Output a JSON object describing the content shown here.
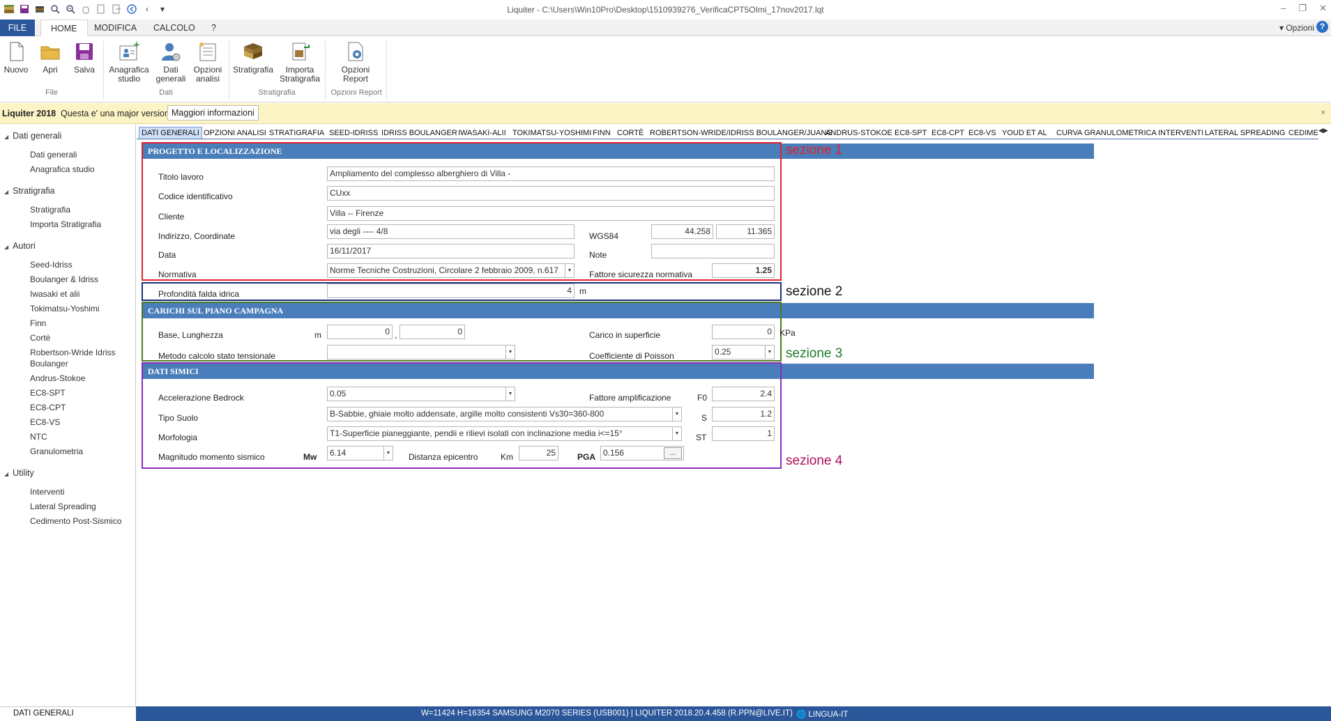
{
  "window": {
    "title": "Liquiter - C:\\Users\\Win10Pro\\Desktop\\1510939276_VerificaCPT5OImi_17nov2017.lqt"
  },
  "ribbon_tabs": [
    "FILE",
    "HOME",
    "MODIFICA",
    "CALCOLO",
    "?"
  ],
  "ribbon_right": {
    "options": "Opzioni",
    "options_arrow": "▾",
    "help": "?"
  },
  "ribbon": {
    "nuovo": "Nuovo",
    "apri": "Apri",
    "salva": "Salva",
    "group_file": "File",
    "anagrafica_line1": "Anagrafica",
    "anagrafica_line2": "studio",
    "dati_line1": "Dati",
    "dati_line2": "generali",
    "opzioni_line1": "Opzioni",
    "opzioni_line2": "analisi",
    "group_dati": "Dati",
    "stratigrafia": "Stratigrafia",
    "importa_line1": "Importa",
    "importa_line2": "Stratigrafia",
    "group_stratigrafia": "Stratigrafia",
    "report_line1": "Opzioni",
    "report_line2": "Report",
    "group_report": "Opzioni Report"
  },
  "infobar": {
    "app": "Liquiter 2018",
    "message": "Questa e' una major version",
    "more": "Maggiori informazioni",
    "close": "×"
  },
  "nav": {
    "groups": [
      "Dati generali",
      "Stratigrafia",
      "Autori",
      "Utility"
    ],
    "dati": [
      "Dati generali",
      "Anagrafica studio"
    ],
    "strat": [
      "Stratigrafia",
      "Importa Stratigrafia"
    ],
    "autori": [
      "Seed-Idriss",
      "Boulanger & Idriss",
      "Iwasaki et alii",
      "Tokimatsu-Yoshimi",
      "Finn",
      "Cortè",
      "Robertson-Wride Idriss",
      "Boulanger",
      "Andrus-Stokoe",
      "EC8-SPT",
      "EC8-CPT",
      "EC8-VS",
      "NTC",
      "Granulometria"
    ],
    "utility": [
      "Interventi",
      "Lateral Spreading",
      "Cedimento Post-Sismico"
    ]
  },
  "content_tabs": [
    "DATI GENERALI",
    "OPZIONI ANALISI",
    "STRATIGRAFIA",
    "SEED-IDRISS",
    "IDRISS BOULANGER",
    "IWASAKI-ALII",
    "TOKIMATSU-YOSHIMI",
    "FINN",
    "CORTÈ",
    "ROBERTSON-WRIDE/IDRISS BOULANGER/JUANG",
    "ANDRUS-STOKOE",
    "EC8-SPT",
    "EC8-CPT",
    "EC8-VS",
    "YOUD ET AL",
    "CURVA GRANULOMETRICA",
    "INTERVENTI",
    "LATERAL SPREADING",
    "CEDIMEN"
  ],
  "sections": {
    "s1": {
      "header": "PROGETTO E LOCALIZZAZIONE",
      "label": "sezione 1",
      "titolo_label": "Titolo lavoro",
      "titolo": "Ampliamento del complesso alberghiero di Villa -",
      "codice_label": "Codice identificativo",
      "codice": "CUxx",
      "cliente_label": "Cliente",
      "cliente": "Villa --  Firenze",
      "indirizzo_label": "Indirizzo, Coordinate",
      "indirizzo": "via degli ---- 4/8",
      "wgs_label": "WGS84",
      "lat": "44.258",
      "lon": "11.365",
      "data_label": "Data",
      "data": "16/11/2017",
      "note_label": "Note",
      "note": "",
      "normativa_label": "Normativa",
      "normativa": "Norme Tecniche Costruzioni, Circolare 2 febbraio 2009, n.617",
      "fattore_label": "Fattore sicurezza normativa",
      "fattore": "1.25"
    },
    "s2": {
      "label": "sezione 2",
      "falda_label": "Profondità falda idrica",
      "falda": "4",
      "unit": "m"
    },
    "s3": {
      "header": "CARICHI SUL PIANO CAMPAGNA",
      "label": "sezione 3",
      "base_label": "Base, Lunghezza",
      "unit_m": "m",
      "base": "0",
      "comma": ",",
      "lunghezza": "0",
      "carico_label": "Carico in superficie",
      "carico": "0",
      "carico_unit": "KPa",
      "metodo_label": "Metodo calcolo stato tensionale",
      "metodo": "",
      "poisson_label": "Coefficiente di Poisson",
      "poisson": "0.25"
    },
    "s4": {
      "header": "DATI SIMICI",
      "label": "sezione 4",
      "acc_label": "Accelerazione Bedrock",
      "acc": "0.05",
      "fatt_label": "Fattore amplificazione",
      "f0_label": "F0",
      "f0": "2.4",
      "suolo_label": "Tipo Suolo",
      "suolo": "B-Sabbie, ghiaie molto addensate, argille molto consistenti Vs30=360-800",
      "s_label": "S",
      "s": "1.2",
      "morf_label": "Morfologia",
      "morf": "T1-Superficie pianeggiante, pendii e rilievi isolati con inclinazione media i<=15°",
      "st_label": "ST",
      "st": "1",
      "mag_label": "Magnitudo momento sismico",
      "mw_label": "Mw",
      "mw": "6.14",
      "dist_label": "Distanza epicentro",
      "km_label": "Km",
      "dist": "25",
      "pga_label": "PGA",
      "pga": "0.156",
      "dots": "..."
    }
  },
  "status": {
    "left": "DATI GENERALI",
    "mid": "W=11424 H=16354 SAMSUNG M2070 SERIES (USB001) |     LIQUITER 2018.20.4.458 (R.PPN@LIVE.IT)",
    "lang": "LINGUA-IT"
  },
  "colors": {
    "accent": "#2b579a",
    "section_header": "#4a7eba",
    "s1": "#e0212b",
    "s2": "#1c2f7a",
    "s3": "#4d7a1e",
    "s4": "#8a2bbf",
    "label_s1": "#e0212b",
    "label_s2": "#111111",
    "label_s3": "#1e7a2c",
    "label_s4": "#b0105a"
  }
}
